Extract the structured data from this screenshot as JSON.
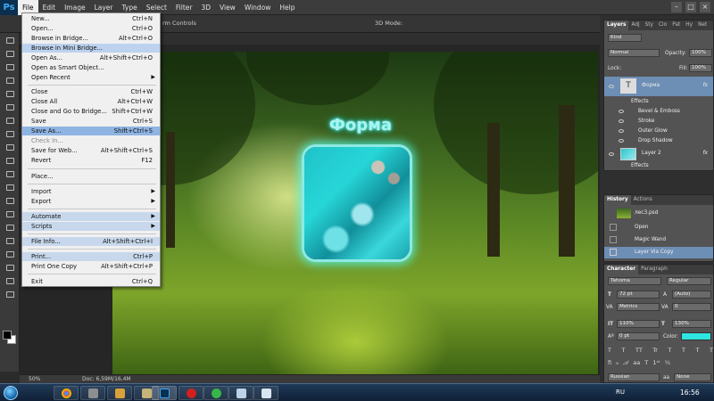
{
  "app": {
    "logo": "Ps"
  },
  "menubar": {
    "items": [
      "File",
      "Edit",
      "Image",
      "Layer",
      "Type",
      "Select",
      "Filter",
      "3D",
      "View",
      "Window",
      "Help"
    ]
  },
  "optbar": {
    "transform_controls": "rm Controls",
    "mode_3d": "3D Mode:"
  },
  "file_menu": {
    "items": [
      {
        "label": "New...",
        "shortcut": "Ctrl+N"
      },
      {
        "label": "Open...",
        "shortcut": "Ctrl+O"
      },
      {
        "label": "Browse in Bridge...",
        "shortcut": "Alt+Ctrl+O"
      },
      {
        "label": "Browse in Mini Bridge...",
        "shortcut": ""
      },
      {
        "label": "Open As...",
        "shortcut": "Alt+Shift+Ctrl+O"
      },
      {
        "label": "Open as Smart Object...",
        "shortcut": ""
      },
      {
        "label": "Open Recent",
        "shortcut": ""
      },
      {
        "label": "Close",
        "shortcut": "Ctrl+W"
      },
      {
        "label": "Close All",
        "shortcut": "Alt+Ctrl+W"
      },
      {
        "label": "Close and Go to Bridge...",
        "shortcut": "Shift+Ctrl+W"
      },
      {
        "label": "Save",
        "shortcut": "Ctrl+S"
      },
      {
        "label": "Save As...",
        "shortcut": "Shift+Ctrl+S"
      },
      {
        "label": "Check In...",
        "shortcut": ""
      },
      {
        "label": "Save for Web...",
        "shortcut": "Alt+Shift+Ctrl+S"
      },
      {
        "label": "Revert",
        "shortcut": "F12"
      },
      {
        "label": "Place...",
        "shortcut": ""
      },
      {
        "label": "Import",
        "shortcut": ""
      },
      {
        "label": "Export",
        "shortcut": ""
      },
      {
        "label": "Automate",
        "shortcut": ""
      },
      {
        "label": "Scripts",
        "shortcut": ""
      },
      {
        "label": "File Info...",
        "shortcut": "Alt+Shift+Ctrl+I"
      },
      {
        "label": "Print...",
        "shortcut": "Ctrl+P"
      },
      {
        "label": "Print One Copy",
        "shortcut": "Alt+Shift+Ctrl+P"
      },
      {
        "label": "Exit",
        "shortcut": "Ctrl+Q"
      }
    ]
  },
  "canvas": {
    "shape_text": "Форма"
  },
  "statusbar": {
    "zoom": "50%",
    "doc_info": "Doc: 6,59M/16,4M"
  },
  "layers_panel": {
    "tabs": [
      "Layers",
      "Adj",
      "Sty",
      "Clo",
      "Pat",
      "Hy",
      "Net"
    ],
    "kind_label": "Kind",
    "blend_mode": "Normal",
    "opacity_label": "Opacity:",
    "opacity_value": "100%",
    "lock_label": "Lock:",
    "fill_label": "Fill:",
    "fill_value": "100%",
    "layers": [
      {
        "name": "Форма",
        "fx": "fx"
      },
      {
        "name": "Effects"
      },
      {
        "name": "Bevel & Emboss"
      },
      {
        "name": "Stroke"
      },
      {
        "name": "Outer Glow"
      },
      {
        "name": "Drop Shadow"
      },
      {
        "name": "Layer 2",
        "fx": "fx"
      },
      {
        "name": "Effects"
      }
    ]
  },
  "history_panel": {
    "tabs": [
      "History",
      "Actions"
    ],
    "items": [
      "лес3.psd",
      "Open",
      "Magic Wand",
      "Layer Via Copy"
    ]
  },
  "character_panel": {
    "tabs": [
      "Character",
      "Paragraph"
    ],
    "font_family": "Tahoma",
    "font_style": "Regular",
    "font_size": "72 pt",
    "leading": "(Auto)",
    "kerning": "Metrics",
    "tracking": "0",
    "vertical_scale": "110%",
    "horizontal_scale": "130%",
    "baseline_shift": "0 pt",
    "color_label": "Color:",
    "color_value": "#2ee6e0",
    "language": "Russian",
    "antialias": "None",
    "style_buttons": [
      "T",
      "T",
      "TT",
      "Tr",
      "T",
      "T",
      "T",
      "T"
    ]
  },
  "taskbar": {
    "language": "RU",
    "clock": "16:56"
  }
}
